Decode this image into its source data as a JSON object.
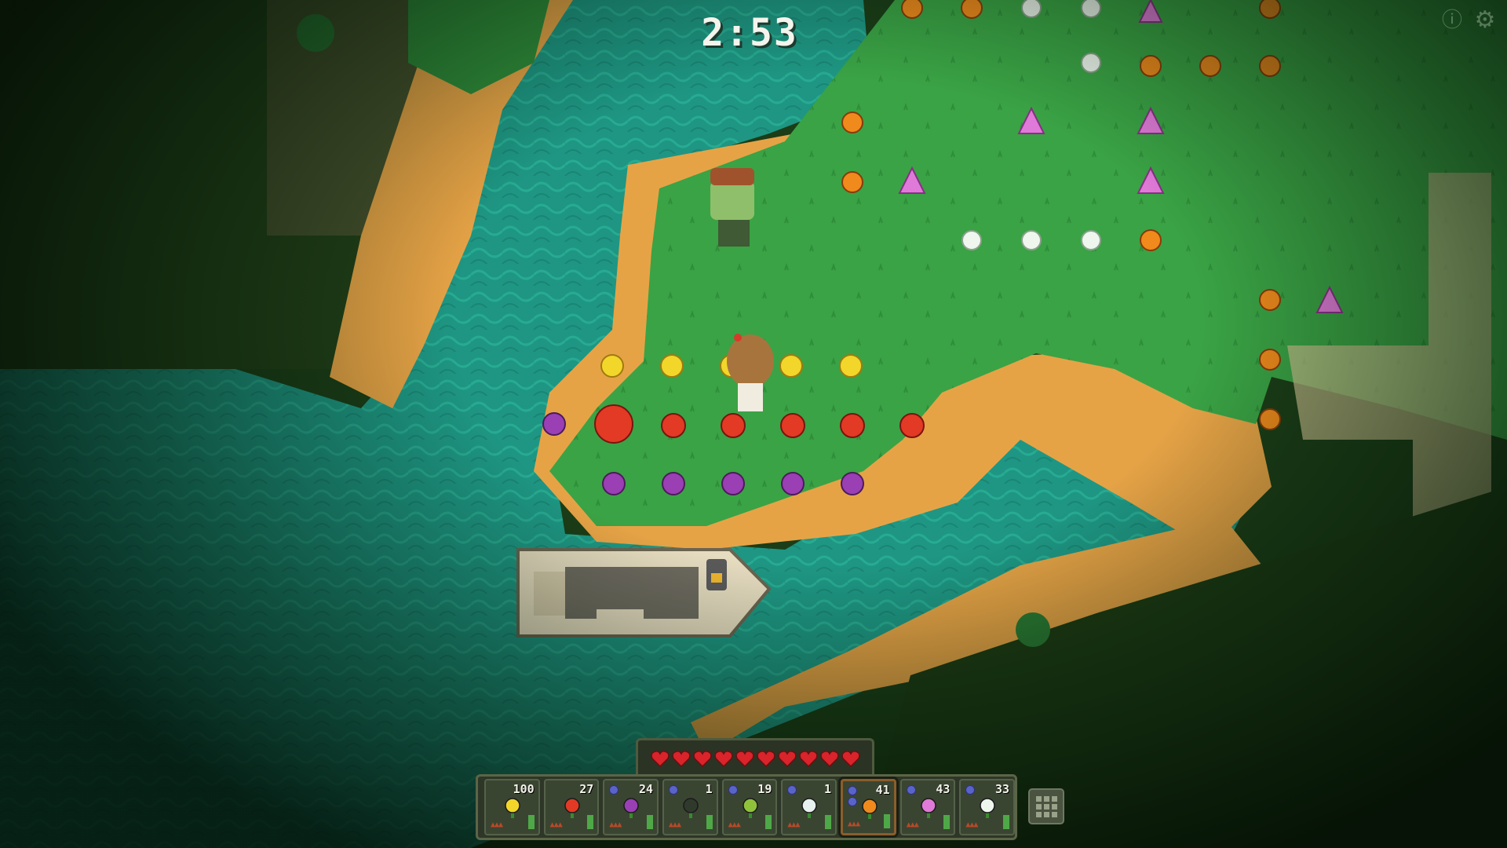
{
  "hud": {
    "timer": "2:53",
    "info_icon": "info-icon",
    "settings_icon": "gear-icon",
    "health": {
      "hearts": 10,
      "max_hearts": 10,
      "heart_color": "#d8242a"
    }
  },
  "hotbar": {
    "selected_index": 6,
    "slots": [
      {
        "item": "yellow-flower",
        "count": "100",
        "color": "#f2d62a"
      },
      {
        "item": "red-flower",
        "count": "27",
        "color": "#e23a24"
      },
      {
        "item": "purple-flower",
        "count": "24",
        "color": "#9a3fb4"
      },
      {
        "item": "dark-seed",
        "count": "1",
        "color": "#2f3a2c"
      },
      {
        "item": "sprout",
        "count": "19",
        "color": "#8fc23a"
      },
      {
        "item": "white-seed",
        "count": "1",
        "color": "#e8f0f0"
      },
      {
        "item": "orange-flower",
        "count": "41",
        "color": "#f08a1c"
      },
      {
        "item": "pink-flower",
        "count": "43",
        "color": "#e07ad8"
      },
      {
        "item": "white-flower",
        "count": "33",
        "color": "#eef6ee"
      }
    ],
    "inventory_icon": "grid-icon"
  },
  "world": {
    "palette": {
      "water": "#1f9a86",
      "grass": "#3aa345",
      "sand": "#e8a548",
      "dark_forest": "#1a3a16"
    }
  }
}
